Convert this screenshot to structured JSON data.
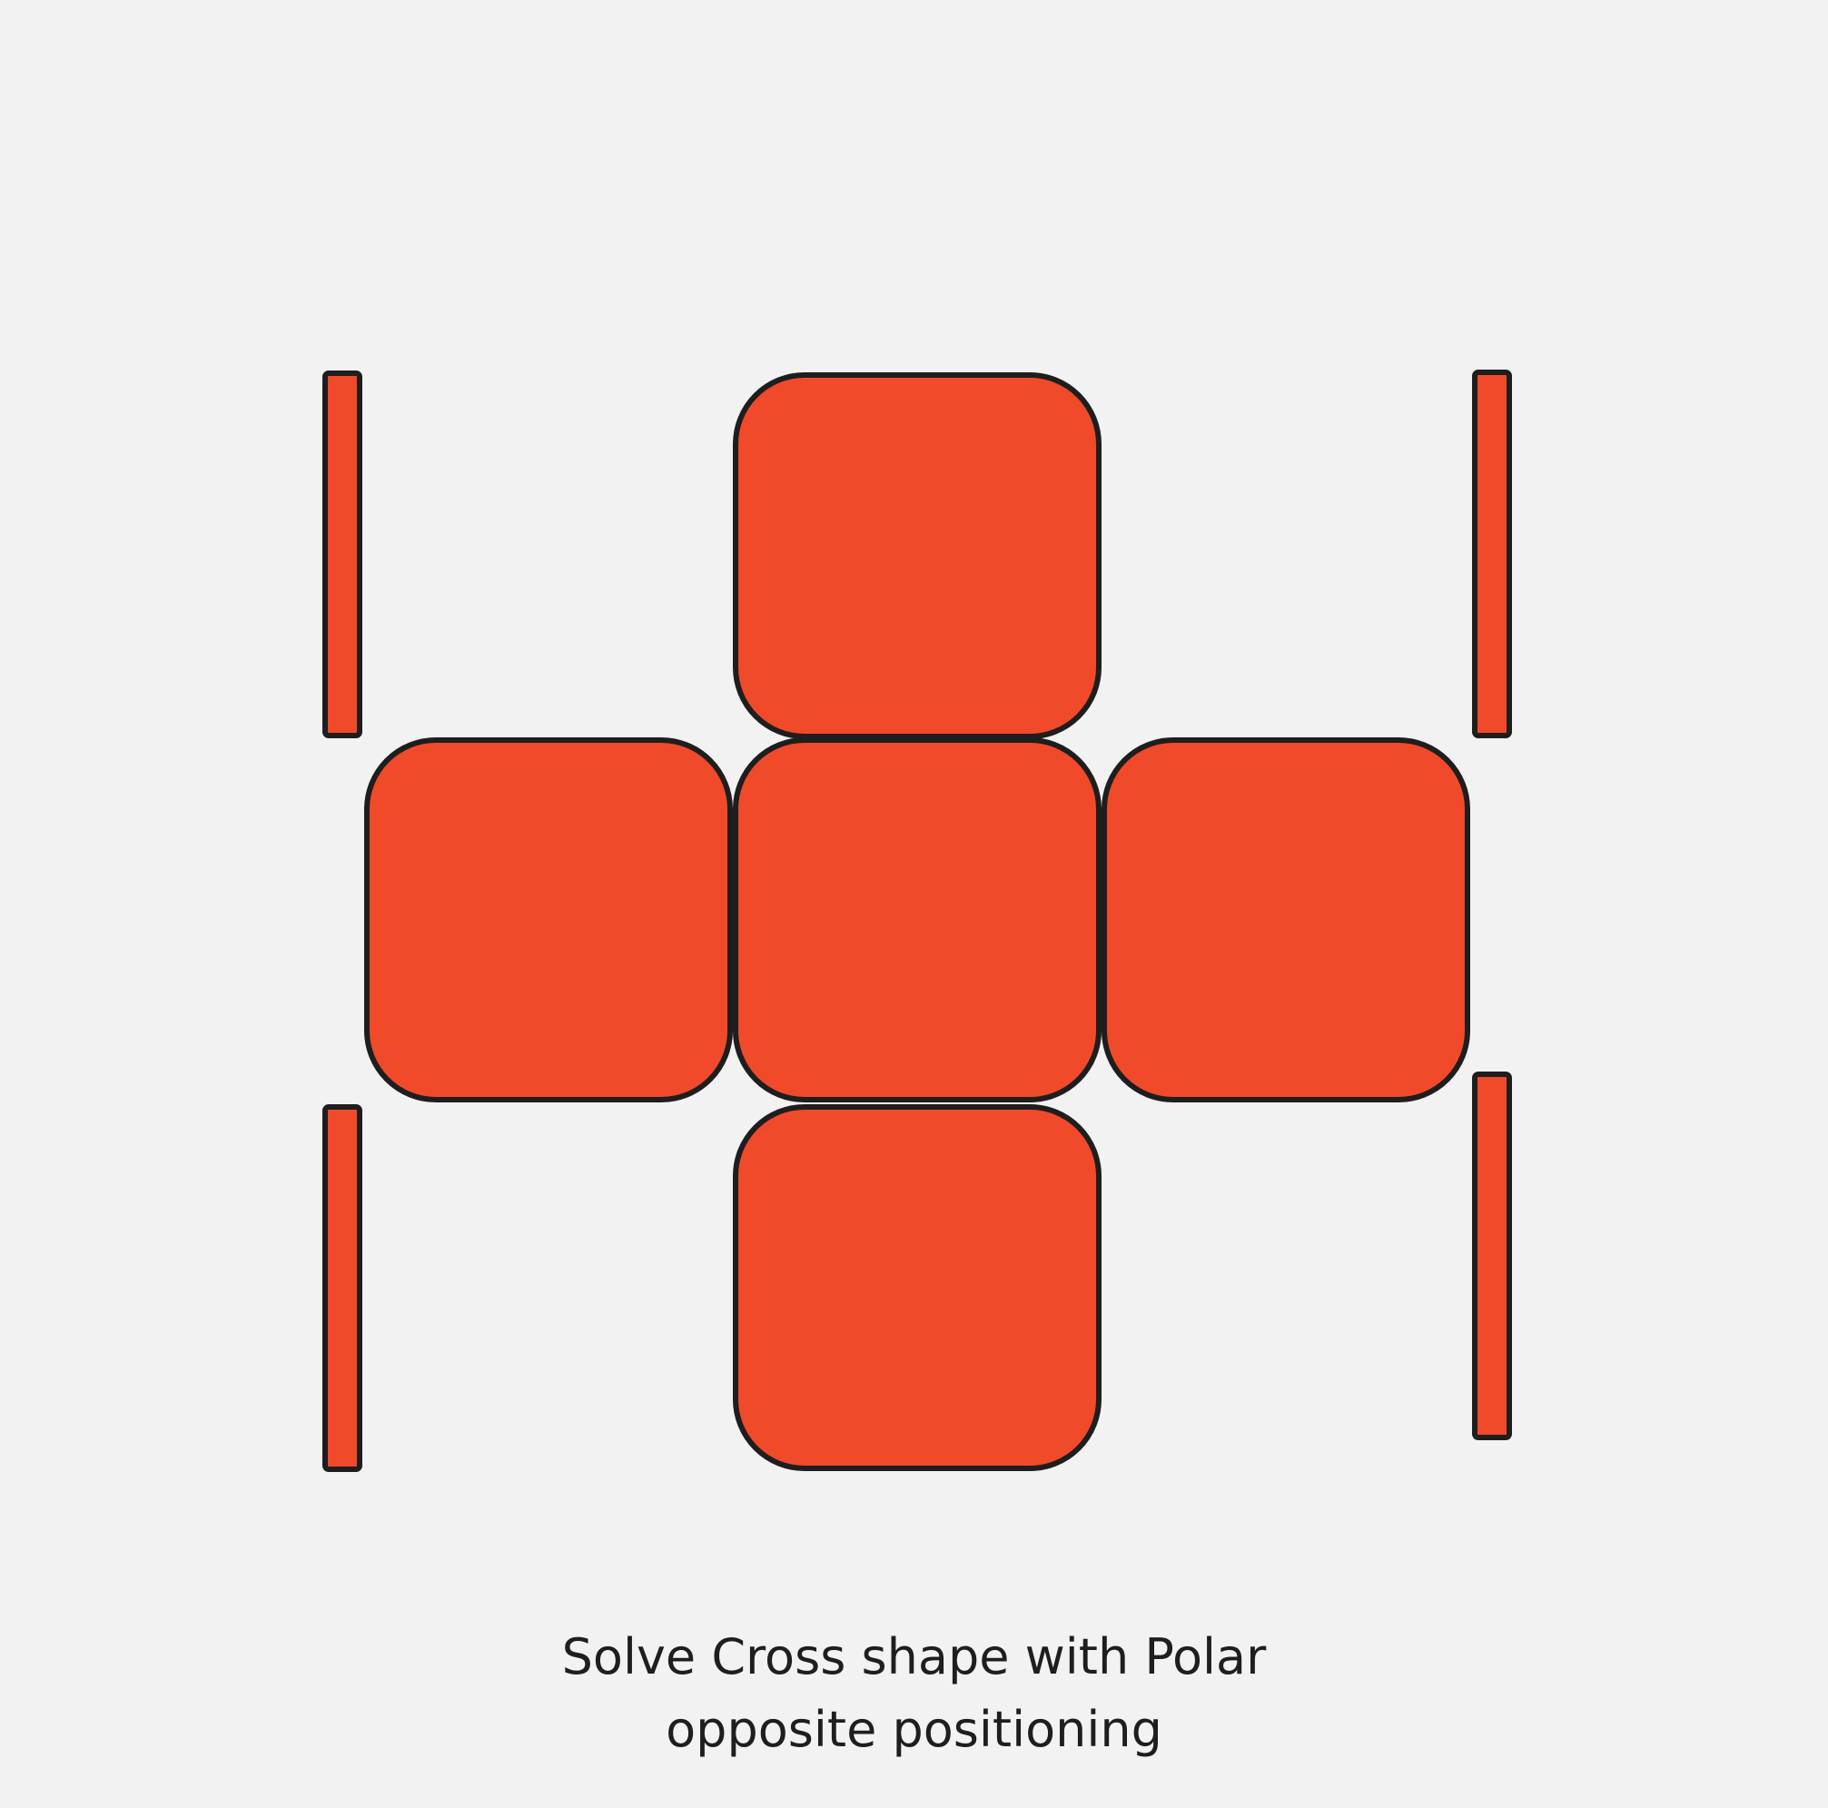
{
  "caption": {
    "line1": "Solve Cross shape with Polar",
    "line2": "opposite positioning"
  },
  "colors": {
    "background": "#f2f2f2",
    "fill": "#f04a2a",
    "stroke": "#1e1e1e"
  }
}
